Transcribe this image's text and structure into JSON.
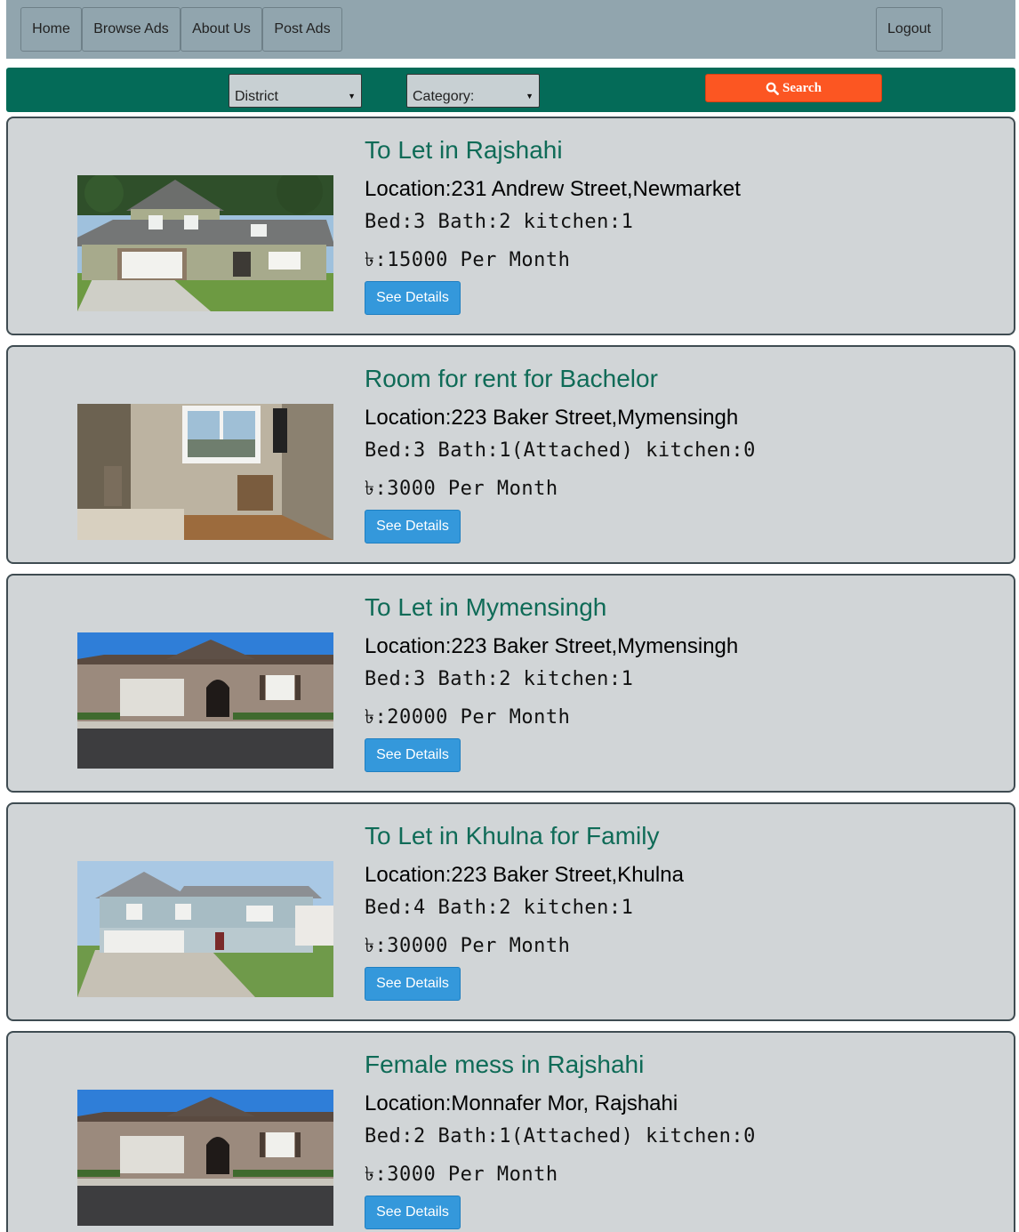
{
  "nav": {
    "items": [
      {
        "label": "Home"
      },
      {
        "label": "Browse Ads"
      },
      {
        "label": "About Us"
      },
      {
        "label": "Post Ads"
      }
    ],
    "logout_label": "Logout"
  },
  "search": {
    "district_label": "District",
    "category_label": "Category:",
    "button_label": "Search",
    "button_icon": "search-icon"
  },
  "colors": {
    "navbar": "#91a5ae",
    "searchbar": "#046b58",
    "search_button": "#fc5622",
    "card_background": "#d1d5d7",
    "title_text": "#0f6b57",
    "details_button": "#3498db"
  },
  "listings": [
    {
      "title": "To Let in Rajshahi",
      "location": "Location:231 Andrew Street,Newmarket",
      "rooms": "Bed:3 Bath:2 kitchen:1",
      "price": "৳:15000 Per Month",
      "button_label": "See Details",
      "photo": "two-storey-house-with-garage-photo"
    },
    {
      "title": "Room for rent for Bachelor",
      "location": "Location:223 Baker Street,Mymensingh",
      "rooms": "Bed:3 Bath:1(Attached) kitchen:0",
      "price": "৳:3000 Per Month",
      "button_label": "See Details",
      "photo": "room-interior-photo"
    },
    {
      "title": "To Let in Mymensingh",
      "location": "Location:223 Baker Street,Mymensingh",
      "rooms": "Bed:3 Bath:2 kitchen:1",
      "price": "৳:20000 Per Month",
      "button_label": "See Details",
      "photo": "single-storey-house-photo"
    },
    {
      "title": "To Let in Khulna for Family",
      "location": "Location:223 Baker Street,Khulna",
      "rooms": "Bed:4 Bath:2 kitchen:1",
      "price": "৳:30000 Per Month",
      "button_label": "See Details",
      "photo": "blue-house-with-driveway-photo"
    },
    {
      "title": "Female mess in Rajshahi",
      "location": "Location:Monnafer Mor, Rajshahi",
      "rooms": "Bed:2 Bath:1(Attached) kitchen:0",
      "price": "৳:3000 Per Month",
      "button_label": "See Details",
      "photo": "single-storey-house-photo"
    }
  ]
}
